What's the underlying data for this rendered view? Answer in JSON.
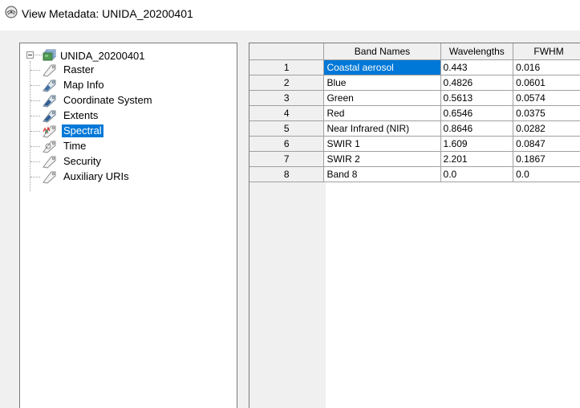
{
  "window": {
    "title": "View Metadata: UNIDA_20200401",
    "icon": "metadata-globe-icon"
  },
  "tree": {
    "root_label": "UNIDA_20200401",
    "root_icon": "raster-stack-icon",
    "items": [
      {
        "label": "Raster",
        "icon": "tag-icon",
        "selected": false
      },
      {
        "label": "Map Info",
        "icon": "tag-icon",
        "selected": false
      },
      {
        "label": "Coordinate System",
        "icon": "tag-icon",
        "selected": false
      },
      {
        "label": "Extents",
        "icon": "tag-icon",
        "selected": false
      },
      {
        "label": "Spectral",
        "icon": "spectral-tag-icon",
        "selected": true
      },
      {
        "label": "Time",
        "icon": "tag-icon",
        "selected": false
      },
      {
        "label": "Security",
        "icon": "tag-icon",
        "selected": false
      },
      {
        "label": "Auxiliary URIs",
        "icon": "tag-icon",
        "selected": false
      }
    ]
  },
  "table": {
    "columns": [
      "Band Names",
      "Wavelengths",
      "FWHM"
    ],
    "rows": [
      {
        "num": "1",
        "name": "Coastal aerosol",
        "wavelength": "0.443",
        "fwhm": "0.016"
      },
      {
        "num": "2",
        "name": "Blue",
        "wavelength": "0.4826",
        "fwhm": "0.0601"
      },
      {
        "num": "3",
        "name": "Green",
        "wavelength": "0.5613",
        "fwhm": "0.0574"
      },
      {
        "num": "4",
        "name": "Red",
        "wavelength": "0.6546",
        "fwhm": "0.0375"
      },
      {
        "num": "5",
        "name": "Near Infrared (NIR)",
        "wavelength": "0.8646",
        "fwhm": "0.0282"
      },
      {
        "num": "6",
        "name": "SWIR 1",
        "wavelength": "1.609",
        "fwhm": "0.0847"
      },
      {
        "num": "7",
        "name": "SWIR 2",
        "wavelength": "2.201",
        "fwhm": "0.1867"
      },
      {
        "num": "8",
        "name": "Band 8",
        "wavelength": "0.0",
        "fwhm": "0.0"
      }
    ],
    "selected_cell": {
      "row": 0,
      "column": "name"
    }
  },
  "colors": {
    "selection": "#0078d7",
    "window_bg": "#f0f0f0",
    "panel_bg": "#ffffff",
    "grid_empty_bg": "#ababab"
  }
}
